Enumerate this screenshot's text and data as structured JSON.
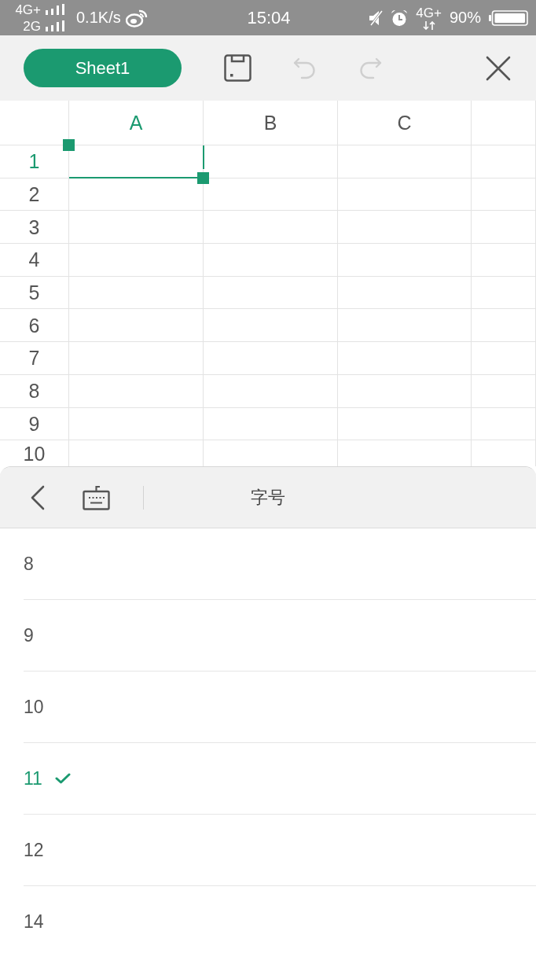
{
  "status_bar": {
    "sim_1": "4G+",
    "sim_2": "2G",
    "data_speed": "0.1K/s",
    "time": "15:04",
    "network": "4G+",
    "battery": "90%"
  },
  "toolbar": {
    "sheet_tab": "Sheet1",
    "undo": {
      "disabled": true
    },
    "redo": {
      "disabled": true
    }
  },
  "sheet": {
    "columns": [
      {
        "label": "A",
        "selected": true
      },
      {
        "label": "B",
        "selected": false
      },
      {
        "label": "C",
        "selected": false
      }
    ],
    "rows": [
      {
        "label": "1",
        "selected": true
      },
      {
        "label": "2",
        "selected": false
      },
      {
        "label": "3",
        "selected": false
      },
      {
        "label": "4",
        "selected": false
      },
      {
        "label": "5",
        "selected": false
      },
      {
        "label": "6",
        "selected": false
      },
      {
        "label": "7",
        "selected": false
      },
      {
        "label": "8",
        "selected": false
      },
      {
        "label": "9",
        "selected": false
      },
      {
        "label": "10",
        "selected": false
      }
    ]
  },
  "panel": {
    "title": "字号",
    "options": [
      {
        "label": "8",
        "selected": false
      },
      {
        "label": "9",
        "selected": false
      },
      {
        "label": "10",
        "selected": false
      },
      {
        "label": "11",
        "selected": true
      },
      {
        "label": "12",
        "selected": false
      },
      {
        "label": "14",
        "selected": false
      }
    ]
  }
}
